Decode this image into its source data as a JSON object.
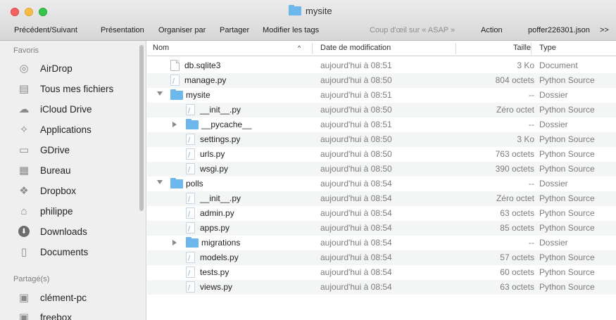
{
  "window": {
    "title": "mysite"
  },
  "toolbar": {
    "nav": "Précédent/Suivant",
    "view": "Présentation",
    "arrange": "Organiser par",
    "share": "Partager",
    "tags": "Modifier les tags",
    "quicklook": "Coup d'œil sur « ASAP »",
    "action": "Action",
    "file": "poffer226301.json",
    "overflow": ">>"
  },
  "sidebar": {
    "favorites_header": "Favoris",
    "favorites": [
      {
        "label": "AirDrop",
        "icon": "airdrop-icon"
      },
      {
        "label": "Tous mes fichiers",
        "icon": "all-files-icon"
      },
      {
        "label": "iCloud Drive",
        "icon": "cloud-icon"
      },
      {
        "label": "Applications",
        "icon": "applications-icon"
      },
      {
        "label": "GDrive",
        "icon": "folder-icon"
      },
      {
        "label": "Bureau",
        "icon": "desktop-icon"
      },
      {
        "label": "Dropbox",
        "icon": "dropbox-icon"
      },
      {
        "label": "philippe",
        "icon": "home-icon"
      },
      {
        "label": "Downloads",
        "icon": "downloads-icon"
      },
      {
        "label": "Documents",
        "icon": "documents-icon"
      }
    ],
    "shared_header": "Partagé(s)",
    "shared": [
      {
        "label": "clément-pc",
        "icon": "computer-icon"
      },
      {
        "label": "freebox",
        "icon": "computer-icon"
      }
    ]
  },
  "columns": {
    "name": "Nom",
    "sort_indicator": "^",
    "date": "Date de modification",
    "size": "Taille",
    "type": "Type"
  },
  "files": [
    {
      "name": "db.sqlite3",
      "date": "aujourd'hui à 08:51",
      "size": "3 Ko",
      "type": "Document",
      "kind": "doc",
      "level": 0
    },
    {
      "name": "manage.py",
      "date": "aujourd'hui à 08:50",
      "size": "804 octets",
      "type": "Python Source",
      "kind": "py",
      "level": 0
    },
    {
      "name": "mysite",
      "date": "aujourd'hui à 08:51",
      "size": "--",
      "type": "Dossier",
      "kind": "folder",
      "level": 0,
      "disclosure": "open"
    },
    {
      "name": "__init__.py",
      "date": "aujourd'hui à 08:50",
      "size": "Zéro octet",
      "type": "Python Source",
      "kind": "py",
      "level": 1
    },
    {
      "name": "__pycache__",
      "date": "aujourd'hui à 08:51",
      "size": "--",
      "type": "Dossier",
      "kind": "folder",
      "level": 1,
      "disclosure": "closed"
    },
    {
      "name": "settings.py",
      "date": "aujourd'hui à 08:50",
      "size": "3 Ko",
      "type": "Python Source",
      "kind": "py",
      "level": 1
    },
    {
      "name": "urls.py",
      "date": "aujourd'hui à 08:50",
      "size": "763 octets",
      "type": "Python Source",
      "kind": "py",
      "level": 1
    },
    {
      "name": "wsgi.py",
      "date": "aujourd'hui à 08:50",
      "size": "390 octets",
      "type": "Python Source",
      "kind": "py",
      "level": 1
    },
    {
      "name": "polls",
      "date": "aujourd'hui à 08:54",
      "size": "--",
      "type": "Dossier",
      "kind": "folder",
      "level": 0,
      "disclosure": "open"
    },
    {
      "name": "__init__.py",
      "date": "aujourd'hui à 08:54",
      "size": "Zéro octet",
      "type": "Python Source",
      "kind": "py",
      "level": 1
    },
    {
      "name": "admin.py",
      "date": "aujourd'hui à 08:54",
      "size": "63 octets",
      "type": "Python Source",
      "kind": "py",
      "level": 1
    },
    {
      "name": "apps.py",
      "date": "aujourd'hui à 08:54",
      "size": "85 octets",
      "type": "Python Source",
      "kind": "py",
      "level": 1
    },
    {
      "name": "migrations",
      "date": "aujourd'hui à 08:54",
      "size": "--",
      "type": "Dossier",
      "kind": "folder",
      "level": 1,
      "disclosure": "closed"
    },
    {
      "name": "models.py",
      "date": "aujourd'hui à 08:54",
      "size": "57 octets",
      "type": "Python Source",
      "kind": "py",
      "level": 1
    },
    {
      "name": "tests.py",
      "date": "aujourd'hui à 08:54",
      "size": "60 octets",
      "type": "Python Source",
      "kind": "py",
      "level": 1
    },
    {
      "name": "views.py",
      "date": "aujourd'hui à 08:54",
      "size": "63 octets",
      "type": "Python Source",
      "kind": "py",
      "level": 1
    }
  ],
  "colors": {
    "folder": "#6cb7ec",
    "close": "#fc605c",
    "minimize": "#fdbc40",
    "maximize": "#34c84a",
    "muted_text": "#7c7c7c"
  }
}
